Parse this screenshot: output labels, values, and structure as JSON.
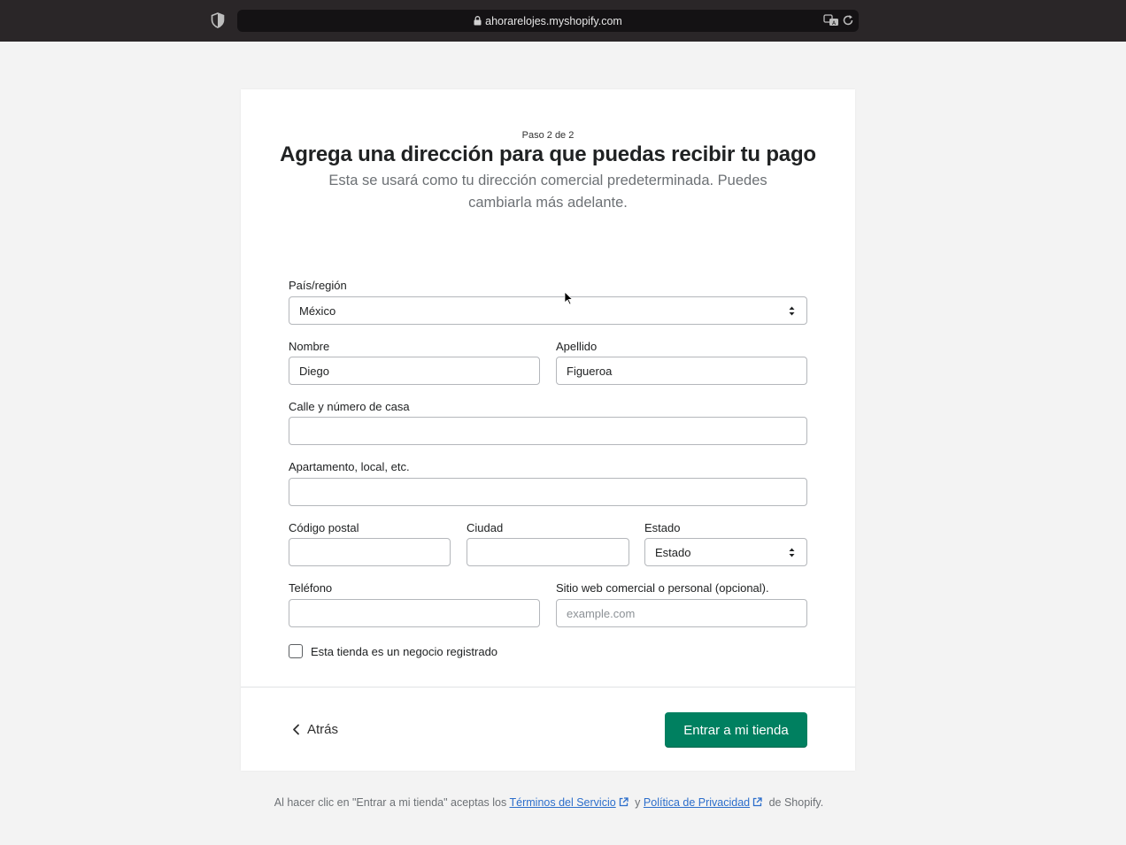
{
  "browser": {
    "url": "ahorarelojes.myshopify.com"
  },
  "header": {
    "step": "Paso 2 de 2",
    "title": "Agrega una dirección para que puedas recibir tu pago",
    "subtitle": "Esta se usará como tu dirección comercial predeterminada. Puedes cambiarla más adelante."
  },
  "form": {
    "country": {
      "label": "País/región",
      "value": "México"
    },
    "first_name": {
      "label": "Nombre",
      "value": "Diego"
    },
    "last_name": {
      "label": "Apellido",
      "value": "Figueroa"
    },
    "street": {
      "label": "Calle y número de casa",
      "value": ""
    },
    "apartment": {
      "label": "Apartamento, local, etc.",
      "value": ""
    },
    "postal_code": {
      "label": "Código postal",
      "value": ""
    },
    "city": {
      "label": "Ciudad",
      "value": ""
    },
    "state": {
      "label": "Estado",
      "value": "Estado"
    },
    "phone": {
      "label": "Teléfono",
      "value": ""
    },
    "website": {
      "label": "Sitio web comercial o personal (opcional).",
      "placeholder": "example.com"
    },
    "registered_business": {
      "label": "Esta tienda es un negocio registrado",
      "checked": false
    }
  },
  "actions": {
    "back_label": "Atrás",
    "submit_label": "Entrar a mi tienda"
  },
  "footer": {
    "prefix": "Al hacer clic en \"Entrar a mi tienda\" aceptas los",
    "terms_link": "Términos del Servicio",
    "and": "y",
    "privacy_link": "Política de Privacidad",
    "suffix": "de Shopify."
  },
  "colors": {
    "primary": "#008060",
    "link": "#2c6ecb"
  }
}
